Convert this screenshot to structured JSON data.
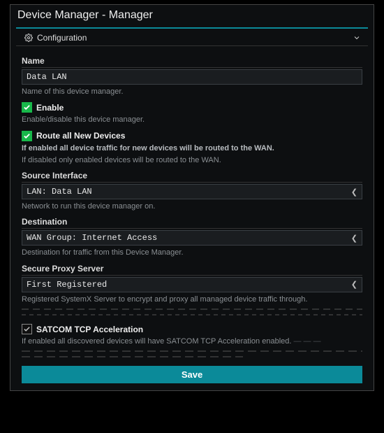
{
  "window": {
    "title": "Device Manager - Manager"
  },
  "section": {
    "title": "Configuration"
  },
  "fields": {
    "name": {
      "label": "Name",
      "value": "Data LAN",
      "help": "Name of this device manager."
    },
    "enable": {
      "label": "Enable",
      "help": "Enable/disable this device manager.",
      "checked": true
    },
    "route_all": {
      "label": "Route all New Devices",
      "help1": "If enabled all device traffic for new devices will be routed to the WAN.",
      "help2": "If disabled only enabled devices will be routed to the WAN.",
      "checked": true
    },
    "source_if": {
      "label": "Source Interface",
      "value": "LAN: Data LAN",
      "help": "Network to run this device manager on."
    },
    "destination": {
      "label": "Destination",
      "value": "WAN Group: Internet Access",
      "help": "Destination for traffic from this Device Manager."
    },
    "proxy": {
      "label": "Secure Proxy Server",
      "value": "First Registered",
      "help": "Registered SystemX Server to encrypt and proxy all managed device traffic through."
    },
    "satcom": {
      "label": "SATCOM TCP Acceleration",
      "help": "If enabled all discovered devices will have SATCOM TCP Acceleration enabled.",
      "checked": true
    }
  },
  "buttons": {
    "save": "Save"
  },
  "colors": {
    "accent": "#0b8a99",
    "check_green": "#18b84a"
  }
}
